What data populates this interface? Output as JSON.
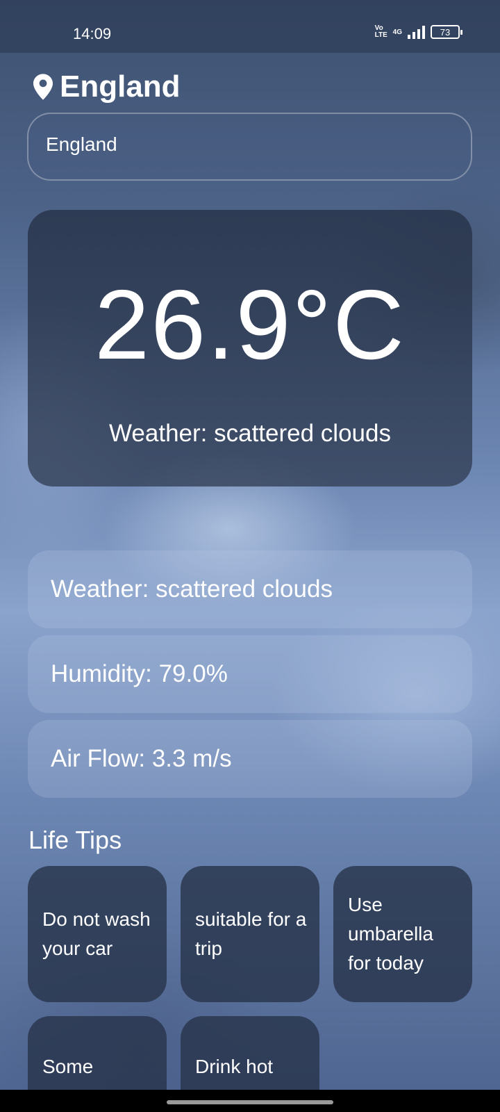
{
  "status_bar": {
    "time": "14:09",
    "volte": "Vo LTE",
    "network": "4G",
    "battery": "73"
  },
  "location": {
    "icon": "map-pin-icon",
    "name": "England"
  },
  "search": {
    "value": "England"
  },
  "current": {
    "temperature": "26.9°C",
    "weather_line": "Weather: scattered clouds"
  },
  "details": [
    {
      "text": "Weather: scattered clouds"
    },
    {
      "text": "Humidity: 79.0%"
    },
    {
      "text": "Air Flow: 3.3 m/s"
    }
  ],
  "life_tips": {
    "title": "Life Tips",
    "items": [
      {
        "text": "Do not wash your car"
      },
      {
        "text": "suitable for a trip"
      },
      {
        "text": "Use umbarella for today"
      },
      {
        "text": "Some"
      },
      {
        "text": "Drink hot"
      }
    ]
  },
  "colors": {
    "card_dark": "#28344c",
    "text": "#ffffff"
  }
}
